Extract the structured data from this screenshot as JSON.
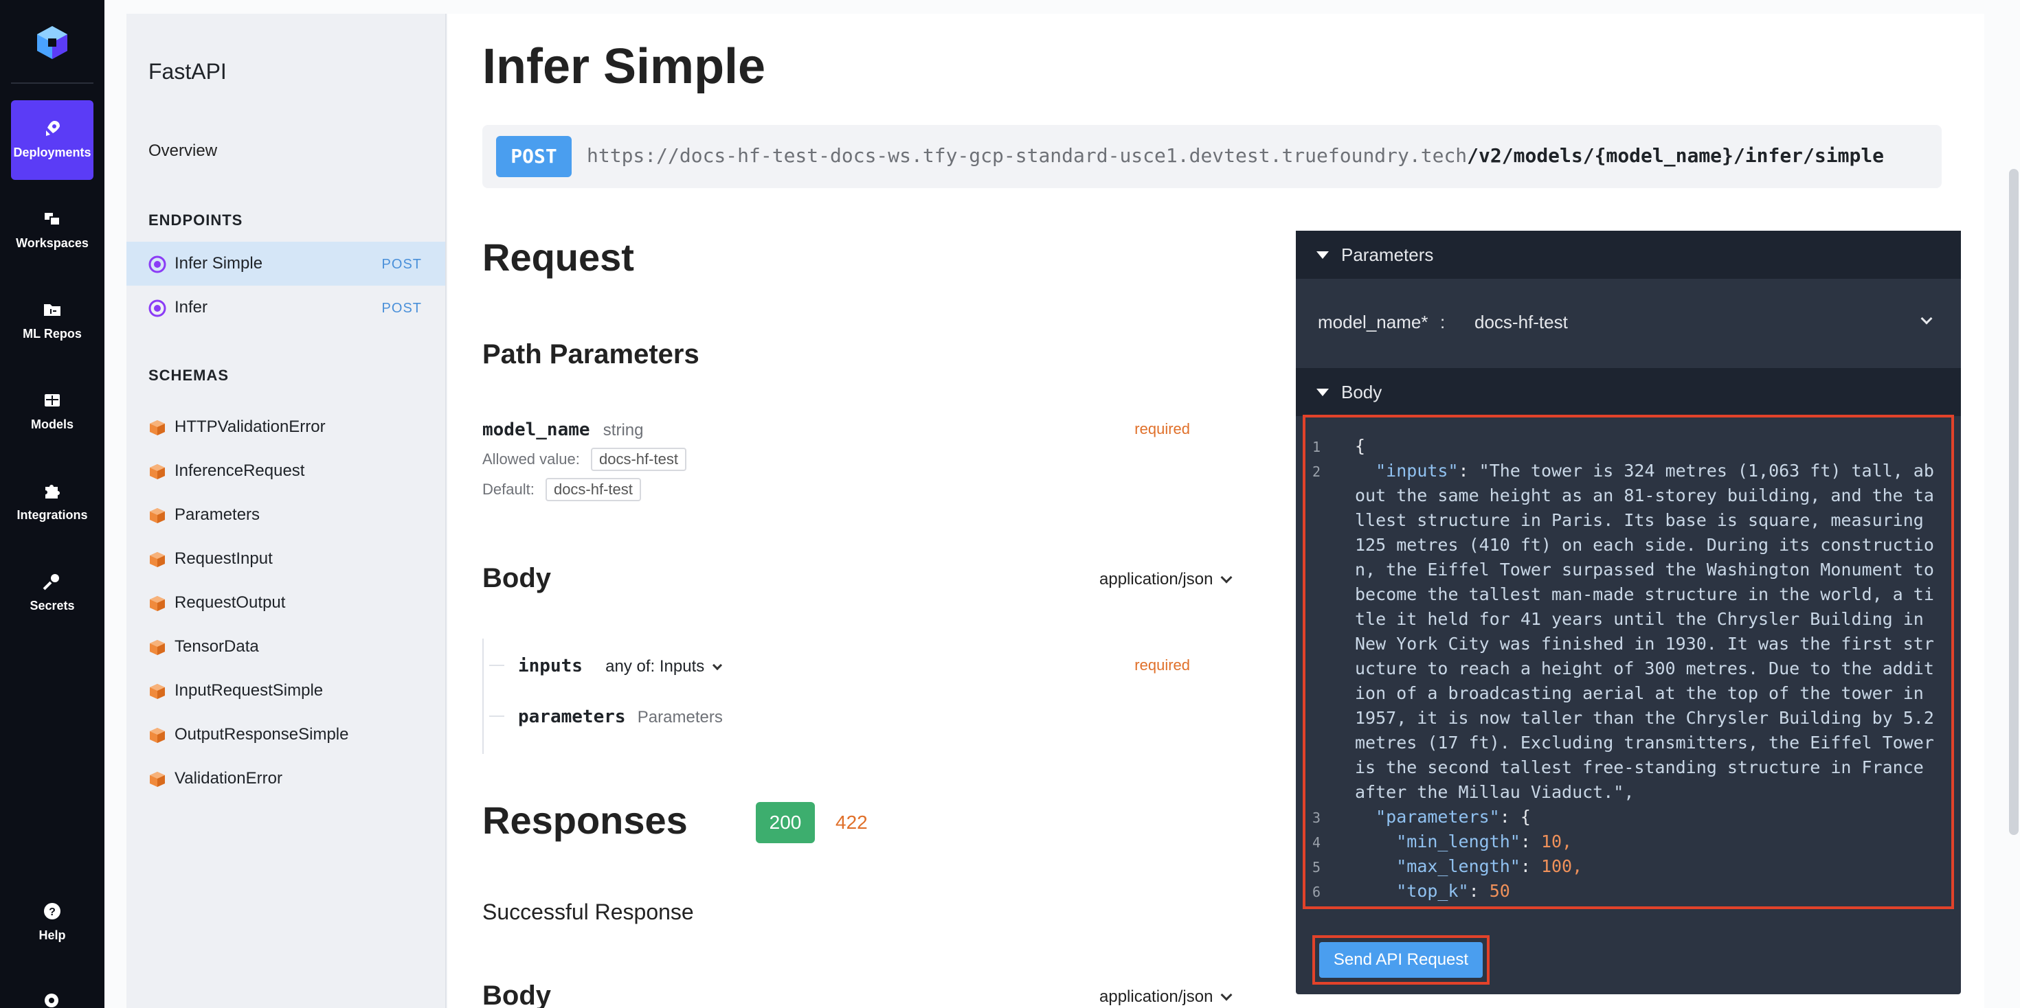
{
  "rail": {
    "items": [
      {
        "label": "Deployments",
        "icon": "rocket-icon"
      },
      {
        "label": "Workspaces",
        "icon": "workspaces-icon"
      },
      {
        "label": "ML Repos",
        "icon": "folder-icon"
      },
      {
        "label": "Models",
        "icon": "grid-icon"
      },
      {
        "label": "Integrations",
        "icon": "puzzle-icon"
      },
      {
        "label": "Secrets",
        "icon": "key-icon"
      }
    ],
    "help_label": "Help",
    "accent_color": "#5b3cf6"
  },
  "sidebar": {
    "app_title": "FastAPI",
    "overview": "Overview",
    "endpoints_heading": "ENDPOINTS",
    "endpoints": [
      {
        "name": "Infer Simple",
        "method": "POST"
      },
      {
        "name": "Infer",
        "method": "POST"
      }
    ],
    "schemas_heading": "SCHEMAS",
    "schemas": [
      "HTTPValidationError",
      "InferenceRequest",
      "Parameters",
      "RequestInput",
      "RequestOutput",
      "TensorData",
      "InputRequestSimple",
      "OutputResponseSimple",
      "ValidationError"
    ]
  },
  "main": {
    "title": "Infer Simple",
    "method": "POST",
    "url_base": "https://docs-hf-test-docs-ws.tfy-gcp-standard-usce1.devtest.truefoundry.tech",
    "url_path": "/v2/models/{model_name}/infer/simple",
    "request_heading": "Request",
    "path_params_heading": "Path Parameters",
    "path_param": {
      "name": "model_name",
      "type": "string",
      "required": "required",
      "allowed_label": "Allowed value:",
      "allowed_value": "docs-hf-test",
      "default_label": "Default:",
      "default_value": "docs-hf-test"
    },
    "body_heading": "Body",
    "body_content_type": "application/json",
    "body_fields": [
      {
        "name": "inputs",
        "type": "any of: Inputs",
        "required": "required"
      },
      {
        "name": "parameters",
        "type": "Parameters"
      }
    ],
    "responses_heading": "Responses",
    "response_codes": [
      "200",
      "422"
    ],
    "success_text": "Successful Response",
    "response_body_heading": "Body",
    "response_content_type": "application/json"
  },
  "panel": {
    "parameters_heading": "Parameters",
    "param_label": "model_name*",
    "param_sep": ":",
    "param_value": "docs-hf-test",
    "body_heading": "Body",
    "code_lines": [
      {
        "ln": "1",
        "text": "{"
      },
      {
        "ln": "2",
        "key": "\"inputs\"",
        "text": "\"The tower is 324 metres (1,063 ft) tall, about the same height as an 81-storey building, and the tallest structure in Paris. Its base is square, measuring 125 metres (410 ft) on each side. During its construction, the Eiffel Tower surpassed the Washington Monument to become the tallest man-made structure in the world, a title it held for 41 years until the Chrysler Building in New York City was finished in 1930. It was the first structure to reach a height of 300 metres. Due to the addition of a broadcasting aerial at the top of the tower in 1957, it is now taller than the Chrysler Building by 5.2 metres (17 ft). Excluding transmitters, the Eiffel Tower is the second tallest free-standing structure in France after the Millau Viaduct.\","
      },
      {
        "ln": "3",
        "key": "\"parameters\"",
        "text": "{"
      },
      {
        "ln": "4",
        "key": "\"min_length\"",
        "text": "10,"
      },
      {
        "ln": "5",
        "key": "\"max_length\"",
        "text": "100,"
      },
      {
        "ln": "6",
        "key": "\"top_k\"",
        "text": "50"
      }
    ],
    "send_label": "Send API Request"
  }
}
